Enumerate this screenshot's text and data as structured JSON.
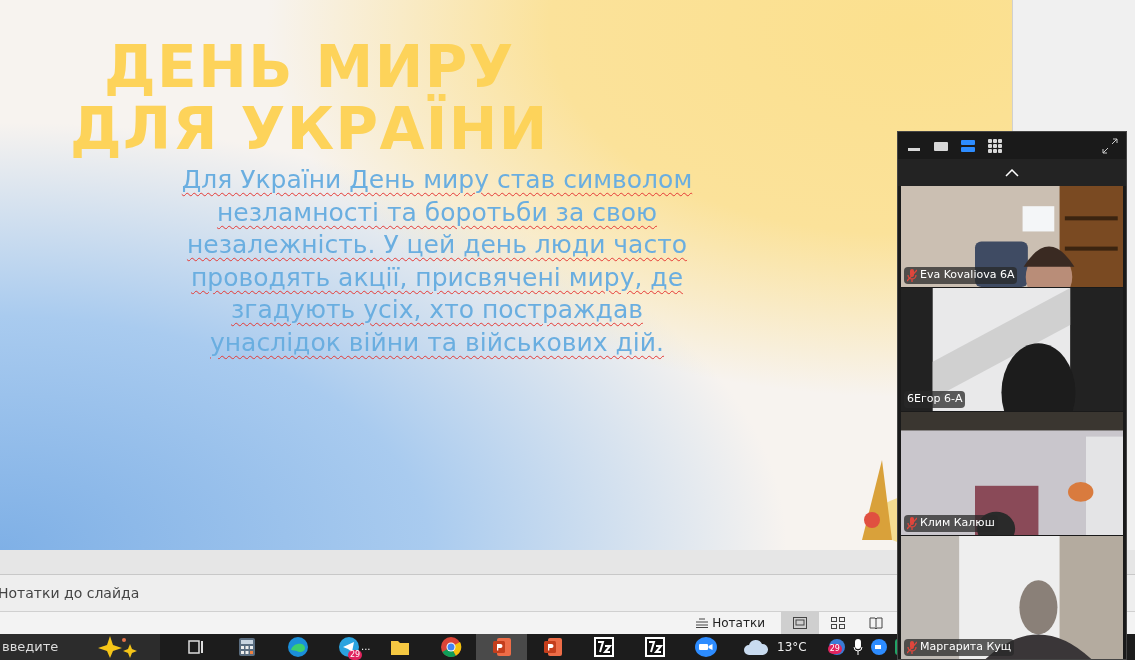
{
  "slide": {
    "title_lines": [
      "ДЕНЬ МИРУ",
      "ДЛЯ УКРАЇНИ"
    ],
    "body_lines": [
      "Для України День миру став символом",
      "незламності та боротьби за свою",
      "незалежність. У цей день люди часто",
      "проводять акції, присвячені миру, де",
      "згадують усіх, хто постраждав",
      "унаслідок війни та військових дій."
    ]
  },
  "notes": {
    "placeholder": "Нотатки до слайда"
  },
  "status_bar": {
    "notes_button": "Нотатки",
    "views": [
      {
        "kind": "normal",
        "selected": true
      },
      {
        "kind": "sorter",
        "selected": false
      },
      {
        "kind": "reading",
        "selected": false
      }
    ]
  },
  "zoom": {
    "layouts": [
      {
        "kind": "minimize",
        "selected": false
      },
      {
        "kind": "speaker",
        "selected": false
      },
      {
        "kind": "strip",
        "selected": true
      },
      {
        "kind": "gallery",
        "selected": false
      }
    ],
    "participants": [
      {
        "name": "Eva Kovaliova 6A",
        "muted": true
      },
      {
        "name": "6Егор 6-А",
        "muted": false
      },
      {
        "name": "Клим Калюш",
        "muted": true
      },
      {
        "name": "Маргарита Кущ",
        "muted": true
      }
    ]
  },
  "taskbar": {
    "search": {
      "value": "введите"
    },
    "apps": [
      {
        "kind": "taskview",
        "selected": false
      },
      {
        "kind": "calculator",
        "selected": false
      },
      {
        "kind": "edge",
        "selected": false
      },
      {
        "kind": "telegram",
        "selected": false,
        "badge": "29",
        "more": "..."
      },
      {
        "kind": "folder",
        "selected": false
      },
      {
        "kind": "chrome",
        "selected": false
      },
      {
        "kind": "powerpoint",
        "selected": true
      },
      {
        "kind": "powerpoint",
        "selected": false
      },
      {
        "kind": "archiver",
        "selected": false
      },
      {
        "kind": "archiver",
        "selected": false
      },
      {
        "kind": "zoom",
        "selected": false
      }
    ],
    "weather": "13°C",
    "tray_badge": "29"
  }
}
